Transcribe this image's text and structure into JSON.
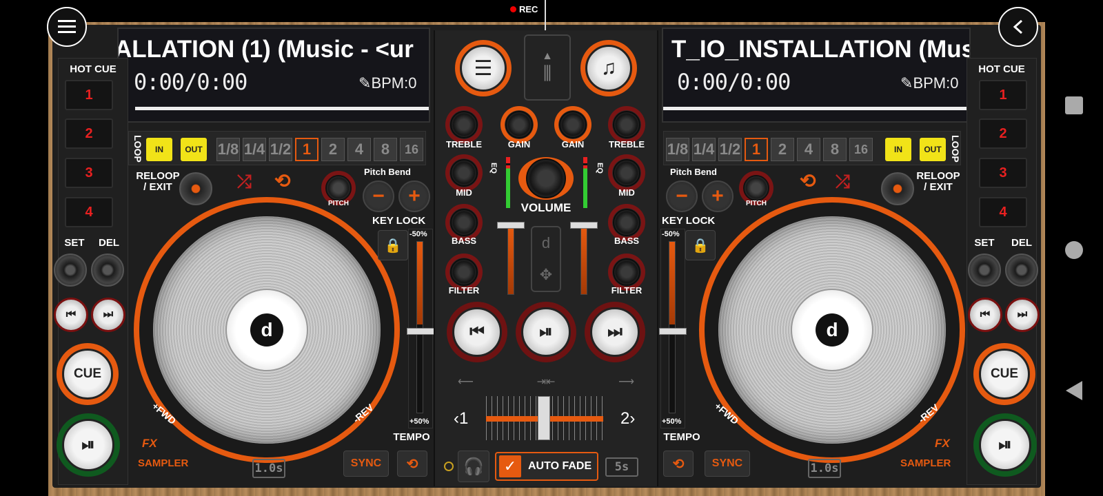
{
  "status": {
    "rec_label": "REC"
  },
  "deck_left": {
    "title": "ALLATION (1) (Music - <ur",
    "time": "0:00/0:00",
    "bpm": "BPM:0",
    "hot_cue_label": "HOT CUE",
    "hot_cues": [
      "1",
      "2",
      "3",
      "4"
    ],
    "set_label": "SET",
    "del_label": "DEL",
    "cue_label": "CUE",
    "loop_label": "LOOP",
    "in_label": "IN",
    "out_label": "OUT",
    "loop_sizes": [
      "1/8",
      "1/4",
      "1/2",
      "1",
      "2",
      "4",
      "8",
      "16"
    ],
    "reloop_label": "RELOOP / EXIT",
    "pitch_bend_label": "Pitch Bend",
    "pitch_label": "PITCH",
    "key_lock_label": "KEY LOCK",
    "pitch_min": "-50%",
    "pitch_max": "+50%",
    "tempo_label": "TEMPO",
    "fwd_label": "+FWD",
    "rev_label": "-REV",
    "fx_label": "FX",
    "sampler_label": "SAMPLER",
    "sync_label": "SYNC",
    "beat_label": "1.0s"
  },
  "deck_right": {
    "title": "T_IO_INSTALLATION (Mus",
    "time": "0:00/0:00",
    "bpm": "BPM:0",
    "hot_cue_label": "HOT CUE",
    "hot_cues": [
      "1",
      "2",
      "3",
      "4"
    ],
    "set_label": "SET",
    "del_label": "DEL",
    "cue_label": "CUE",
    "loop_label": "LOOP",
    "in_label": "IN",
    "out_label": "OUT",
    "loop_sizes": [
      "1/8",
      "1/4",
      "1/2",
      "1",
      "2",
      "4",
      "8",
      "16"
    ],
    "reloop_label": "RELOOP / EXIT",
    "pitch_bend_label": "Pitch Bend",
    "pitch_label": "PITCH",
    "key_lock_label": "KEY LOCK",
    "pitch_min": "-50%",
    "pitch_max": "+50%",
    "tempo_label": "TEMPO",
    "fwd_label": "+FWD",
    "rev_label": "-REV",
    "fx_label": "FX",
    "sampler_label": "SAMPLER",
    "sync_label": "SYNC",
    "beat_label": "1.0s"
  },
  "mixer": {
    "treble_label": "TREBLE",
    "gain_label": "GAIN",
    "mid_label": "MID",
    "bass_label": "BASS",
    "filter_label": "FILTER",
    "eq_label": "EQ",
    "volume_label": "VOLUME",
    "deck1_label": "‹1",
    "deck2_label": "2›",
    "auto_fade_label": "AUTO FADE",
    "auto_fade_time": "5s"
  },
  "icons": {
    "menu": "hamburger-icon",
    "back": "chevron-left-icon",
    "playlist": "list-icon",
    "music_library": "music-note-icon",
    "mixer_toggle": "sliders-icon",
    "headphones": "headphones-icon"
  },
  "colors": {
    "accent": "#e65a10",
    "loop_yellow": "#f1e318",
    "cue_red": "#e82020"
  }
}
